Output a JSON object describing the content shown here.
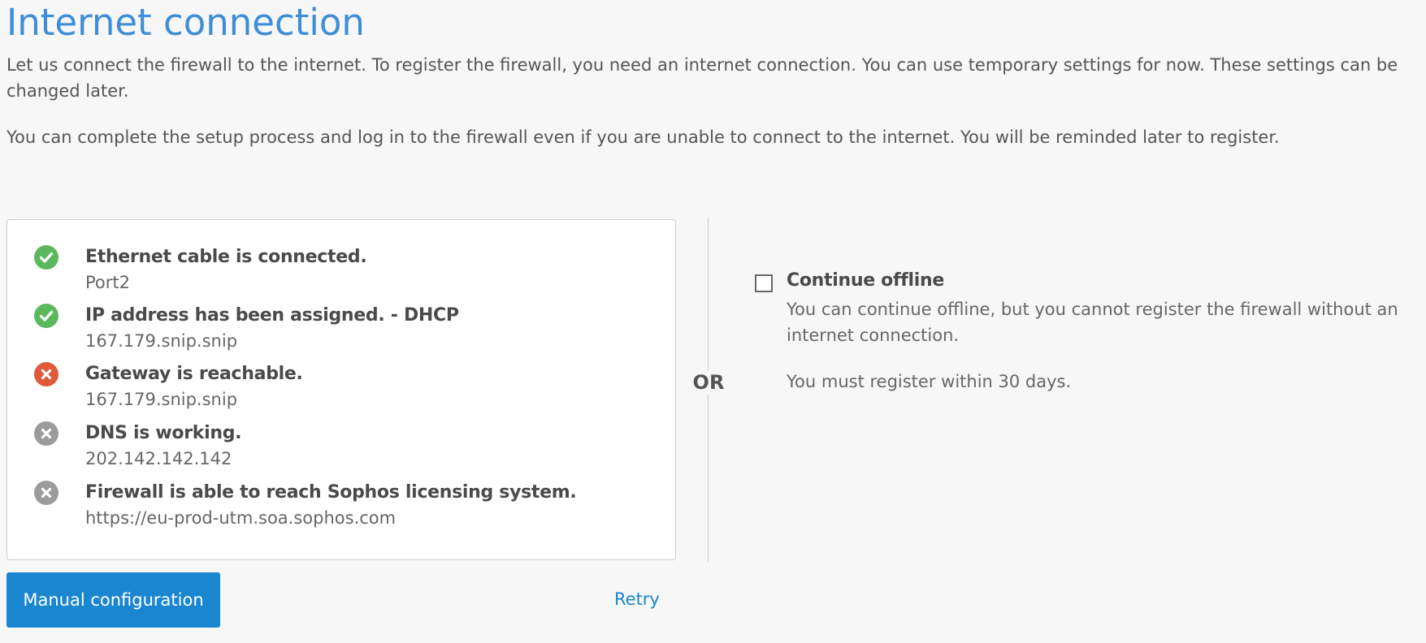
{
  "page": {
    "title": "Internet connection",
    "intro_1": "Let us connect the firewall to the internet. To register the firewall, you need an internet connection. You can use temporary settings for now. These settings can be changed later.",
    "intro_2": "You can complete the setup process and log in to the firewall even if you are unable to connect to the internet. You will be reminded later to register."
  },
  "checks": [
    {
      "title": "Ethernet cable is connected.",
      "detail": "Port2",
      "status": "success",
      "icon": "check-circle-icon"
    },
    {
      "title": "IP address has been assigned. - DHCP",
      "detail": "167.179.snip.snip",
      "status": "success",
      "icon": "check-circle-icon"
    },
    {
      "title": "Gateway is reachable.",
      "detail": "167.179.snip.snip",
      "status": "error",
      "icon": "x-circle-icon"
    },
    {
      "title": "DNS is working.",
      "detail": "202.142.142.142",
      "status": "pending",
      "icon": "x-circle-icon"
    },
    {
      "title": "Firewall is able to reach Sophos licensing system.",
      "detail": "https://eu-prod-utm.soa.sophos.com",
      "status": "pending",
      "icon": "x-circle-icon"
    }
  ],
  "colors": {
    "success": "#5cb85c",
    "error": "#e05a3a",
    "pending": "#9b9b9b",
    "accent": "#1a86d0",
    "title": "#3d8dd9"
  },
  "separator": {
    "label": "OR"
  },
  "offline": {
    "checkbox_label": "Continue offline",
    "checked": false,
    "description": "You can continue offline, but you cannot register the firewall without an internet connection.",
    "note": "You must register within 30 days."
  },
  "actions": {
    "manual_label": "Manual configuration",
    "retry_label": "Retry"
  }
}
